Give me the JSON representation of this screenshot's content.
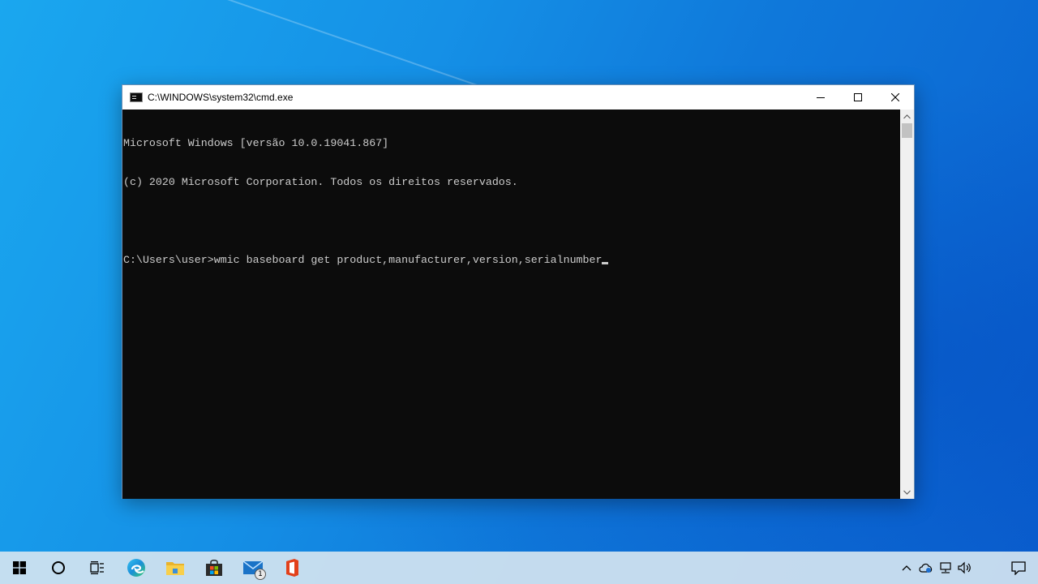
{
  "window": {
    "title": "C:\\WINDOWS\\system32\\cmd.exe"
  },
  "console": {
    "lines": [
      "Microsoft Windows [versão 10.0.19041.867]",
      "(c) 2020 Microsoft Corporation. Todos os direitos reservados.",
      "",
      "C:\\Users\\user>wmic baseboard get product,manufacturer,version,serialnumber"
    ]
  },
  "taskbar": {
    "apps": [
      "start",
      "search",
      "task-view",
      "edge",
      "file-explorer",
      "store",
      "mail",
      "office"
    ],
    "mail_badge": "1"
  },
  "colors": {
    "console_bg": "#0c0c0c",
    "console_fg": "#cccccc",
    "desktop_accent": "#1590e6"
  }
}
